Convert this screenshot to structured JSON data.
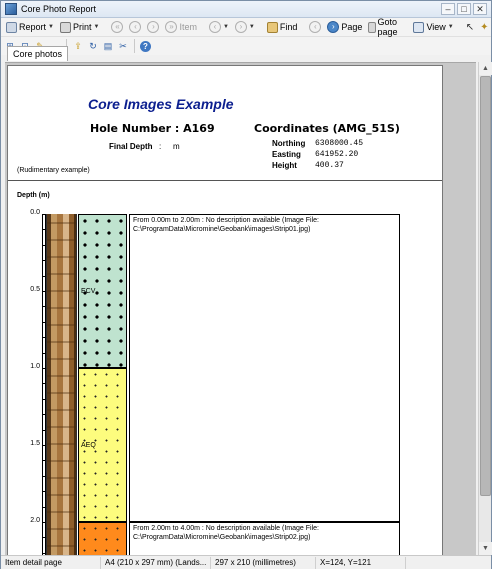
{
  "window": {
    "title": "Core Photo Report",
    "btn_min": "–",
    "btn_max": "□",
    "btn_close": "✕"
  },
  "toolbar1": {
    "report": "Report",
    "print": "Print",
    "item": "Item",
    "find": "Find",
    "page": "Page",
    "goto_page": "Goto page",
    "view": "View"
  },
  "tabs": {
    "active": "Core photos"
  },
  "report": {
    "title": "Core Images Example",
    "hole_number": "Hole Number : A169",
    "coordinates_title": "Coordinates (AMG_51S)",
    "final_depth_label": "Final Depth",
    "final_depth_colon": ":",
    "final_depth_unit": "m",
    "northing_label": "Northing",
    "northing_value": "6308000.45",
    "easting_label": "Easting",
    "easting_value": "641952.20",
    "height_label": "Height",
    "height_value": "400.37",
    "note": "(Rudimentary example)",
    "depth_header": "Depth (m)",
    "depth_ticks": [
      "0.0",
      "0.5",
      "1.0",
      "1.5",
      "2.0"
    ],
    "intervals": [
      {
        "code": "ECV",
        "color": "green",
        "from": 0.0,
        "to": 1.0
      },
      {
        "code": "AEQ",
        "color": "yellow",
        "from": 1.0,
        "to": 2.0
      },
      {
        "code": "",
        "color": "orange",
        "from": 2.0,
        "to": 2.3
      }
    ],
    "descriptions": [
      {
        "text": "From 0.00m to 2.00m : No description available (Image File: C:\\ProgramData\\Micromine\\Geobank\\images\\Strip01.jpg)"
      },
      {
        "text": "From 2.00m to 4.00m : No description available (Image File: C:\\ProgramData\\Micromine\\Geobank\\images\\Strip02.jpg)"
      }
    ]
  },
  "statusbar": {
    "item": "Item detail page",
    "paper": "A4 (210 x 297 mm) (Lands...",
    "size": "297 x 210 (millimetres)",
    "coords": "X=124, Y=121"
  }
}
